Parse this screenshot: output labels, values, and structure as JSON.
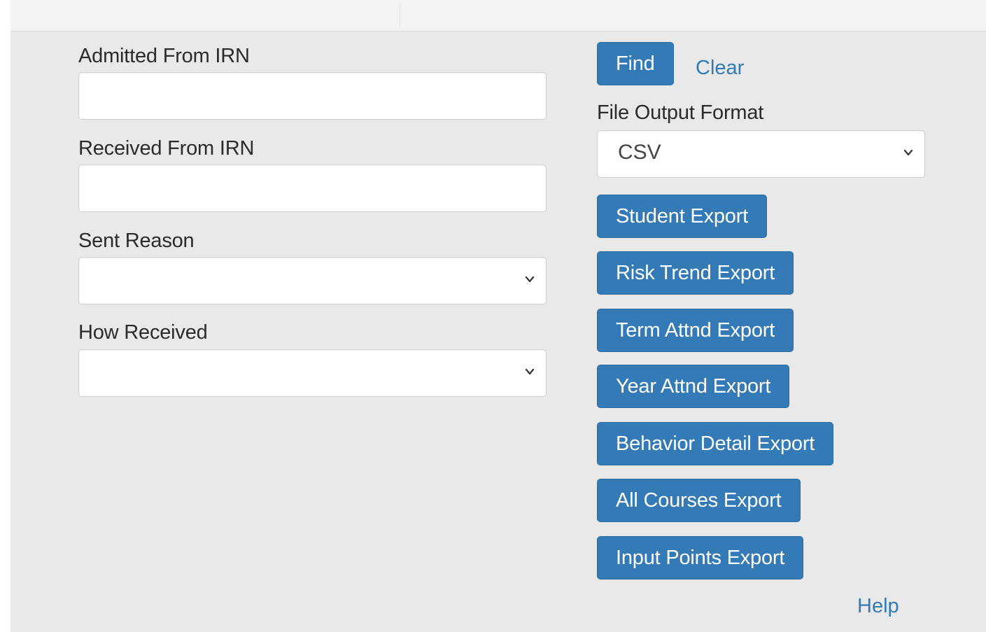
{
  "form": {
    "admitted_from_irn": {
      "label": "Admitted From IRN",
      "value": ""
    },
    "received_from_irn": {
      "label": "Received From IRN",
      "value": ""
    },
    "sent_reason": {
      "label": "Sent Reason",
      "value": ""
    },
    "how_received": {
      "label": "How Received",
      "value": ""
    }
  },
  "actions": {
    "find_label": "Find",
    "clear_label": "Clear"
  },
  "output": {
    "label": "File Output Format",
    "selected": "CSV"
  },
  "exports": [
    "Student Export",
    "Risk Trend Export",
    "Term Attnd Export",
    "Year Attnd Export",
    "Behavior Detail Export",
    "All Courses Export",
    "Input Points Export"
  ],
  "footer": {
    "help_label": "Help"
  },
  "colors": {
    "primary": "#337ab7",
    "background": "#e9e9e9"
  },
  "icons": {
    "select_arrow": "chevron-down-icon"
  }
}
